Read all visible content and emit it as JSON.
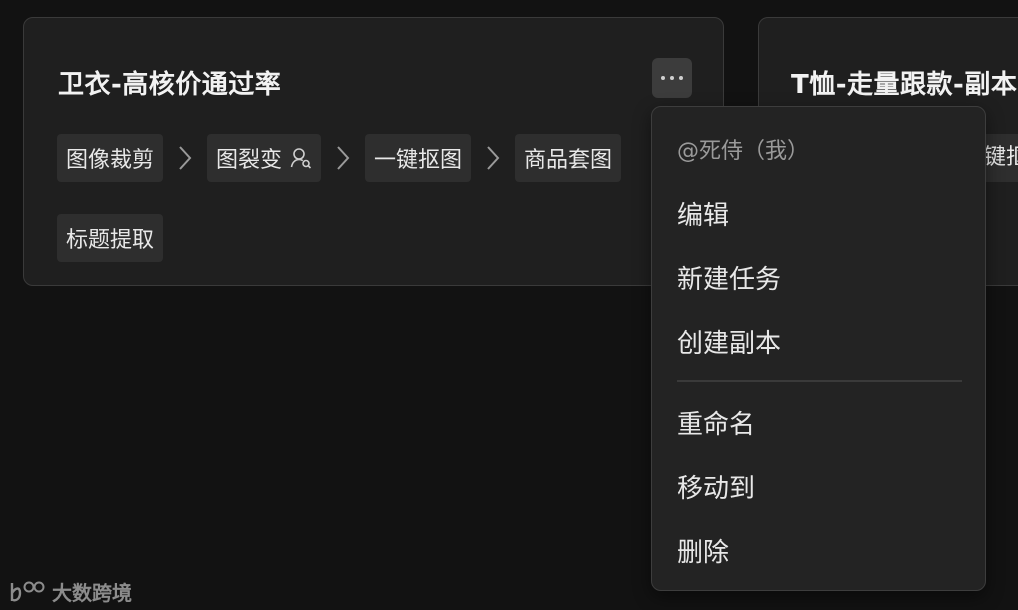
{
  "cards": [
    {
      "title": "卫衣-高核价通过率",
      "steps": [
        {
          "label": "图像裁剪",
          "has_user_icon": false
        },
        {
          "label": "图裂变",
          "has_user_icon": true
        },
        {
          "label": "一键抠图",
          "has_user_icon": false
        },
        {
          "label": "商品套图",
          "has_user_icon": false
        },
        {
          "label": "标题提取",
          "has_user_icon": false
        }
      ]
    },
    {
      "title": "T恤-走量跟款-副本",
      "peek_step": "键抠"
    }
  ],
  "menu": {
    "owner": "@死侍（我）",
    "items": [
      "编辑",
      "新建任务",
      "创建副本"
    ],
    "items_after_divider": [
      "重命名",
      "移动到",
      "删除"
    ]
  },
  "watermark": {
    "text": "大数跨境",
    "logo": "watermark-logo-icon"
  },
  "icons": {
    "more": "more-horizontal-icon",
    "arrow": "chevron-right-icon",
    "user": "user-icon"
  },
  "colors": {
    "background": "#121212",
    "card": "#1f1f1f",
    "step_bg": "#2e2e2e",
    "menu_bg": "#232323"
  }
}
